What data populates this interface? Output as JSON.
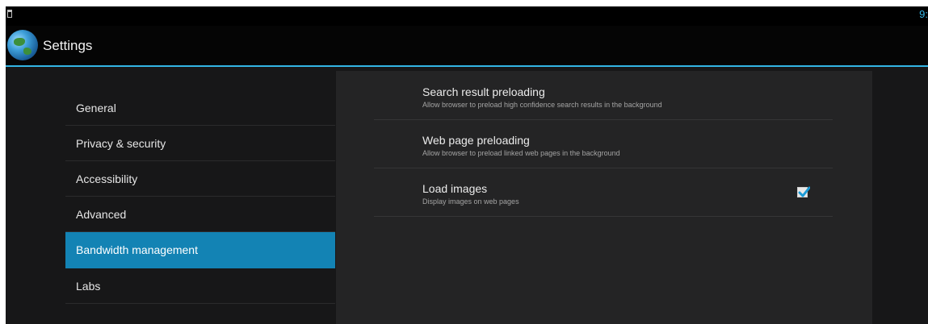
{
  "status_bar": {
    "time": "9:"
  },
  "action_bar": {
    "title": "Settings",
    "icon": "globe-icon"
  },
  "sidebar": {
    "items": [
      {
        "label": "General",
        "selected": false
      },
      {
        "label": "Privacy & security",
        "selected": false
      },
      {
        "label": "Accessibility",
        "selected": false
      },
      {
        "label": "Advanced",
        "selected": false
      },
      {
        "label": "Bandwidth management",
        "selected": true
      },
      {
        "label": "Labs",
        "selected": false
      }
    ]
  },
  "preferences": [
    {
      "title": "Search result preloading",
      "summary": "Allow browser to preload high confidence search results in the background"
    },
    {
      "title": "Web page preloading",
      "summary": "Allow browser to preload linked web pages in the background"
    },
    {
      "title": "Load images",
      "summary": "Display images on web pages",
      "checked": true
    }
  ],
  "colors": {
    "accent": "#33b5e5",
    "selected_item": "#1383b4",
    "background": "#171718",
    "panel": "#242425"
  }
}
